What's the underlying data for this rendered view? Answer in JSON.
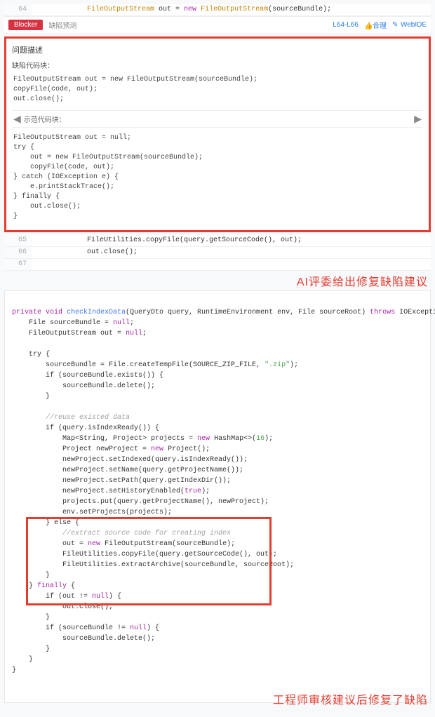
{
  "line_context": {
    "num": "64",
    "line": "FileOutputStream out = new FileOutputStream(sourceBundle);"
  },
  "issue_bar": {
    "badge": "Blocker",
    "type_label": "缺陷预测",
    "range_link": "L64-L66",
    "merge_link": "合理",
    "webide_link": "WebIDE"
  },
  "panel": {
    "title": "问题描述",
    "defect_label": "缺陷代码块：",
    "defect_code": "FileOutputStream out = new FileOutputStream(sourceBundle);\ncopyFile(code, out);\nout.close();",
    "recommend_label": "示范代码块：",
    "recommend_code": "FileOutputStream out = null;\ntry {\n    out = new FileOutputStream(sourceBundle);\n    copyFile(code, out);\n} catch (IOException e) {\n    e.printStackTrace();\n} finally {\n    out.close();\n}"
  },
  "after_lines": [
    {
      "num": "65",
      "code": "            FileUtilities.copyFile(query.getSourceCode(), out);"
    },
    {
      "num": "66",
      "code": "            out.close();"
    },
    {
      "num": "67",
      "code": ""
    }
  ],
  "callout_top": "AI评委给出修复缺陷建议",
  "callout_bottom": "工程师审核建议后修复了缺陷",
  "fixed_code": {
    "l1": "private void ",
    "l1fn": "checkIndexData",
    "l1rest": "(QueryDto query, RuntimeEnvironment env, File sourceRoot) ",
    "l1throws": "throws",
    "l1exc": " IOException {",
    "l2": "    File sourceBundle = ",
    "l2null": "null",
    "l2end": ";",
    "l3": "    FileOutputStream out = ",
    "l3null": "null",
    "l3end": ";",
    "l4": "",
    "l5": "    try {",
    "l6a": "        sourceBundle = File.createTempFile(SOURCE_ZIP_FILE, ",
    "l6str": "\".zip\"",
    "l6end": ");",
    "l7": "        if (sourceBundle.exists()) {",
    "l8": "            sourceBundle.delete();",
    "l9": "        }",
    "l10": "",
    "l11cmt": "        //reuse existed data",
    "l12": "        if (query.isIndexReady()) {",
    "l13a": "            Map<String, Project> projects = ",
    "l13new": "new",
    "l13b": " HashMap<>(",
    "l13num": "16",
    "l13end": ");",
    "l14a": "            Project newProject = ",
    "l14new": "new",
    "l14end": " Project();",
    "l15": "            newProject.setIndexed(query.isIndexReady());",
    "l16": "            newProject.setName(query.getProjectName());",
    "l17": "            newProject.setPath(query.getIndexDir());",
    "l18a": "            newProject.setHistoryEnabled(",
    "l18true": "true",
    "l18end": ");",
    "l19": "            projects.put(query.getProjectName(), newProject);",
    "l20": "            env.setProjects(projects);",
    "l21": "        } else {",
    "l22cmt": "            //extract source code for creating index",
    "l23a": "            out = ",
    "l23new": "new",
    "l23end": " FileOutputStream(sourceBundle);",
    "l24": "            FileUtilities.copyFile(query.getSourceCode(), out);",
    "l25": "            FileUtilities.extractArchive(sourceBundle, sourceRoot);",
    "l26": "        }",
    "l27a": "    } ",
    "l27fin": "finally",
    "l27end": " {",
    "l28a": "        if (out != ",
    "l28null": "null",
    "l28end": ") {",
    "l29": "            out.close();",
    "l30": "        }",
    "l31a": "        if (sourceBundle != ",
    "l31null": "null",
    "l31end": ") {",
    "l32": "            sourceBundle.delete();",
    "l33": "        }",
    "l34": "    }",
    "l35": "}"
  }
}
